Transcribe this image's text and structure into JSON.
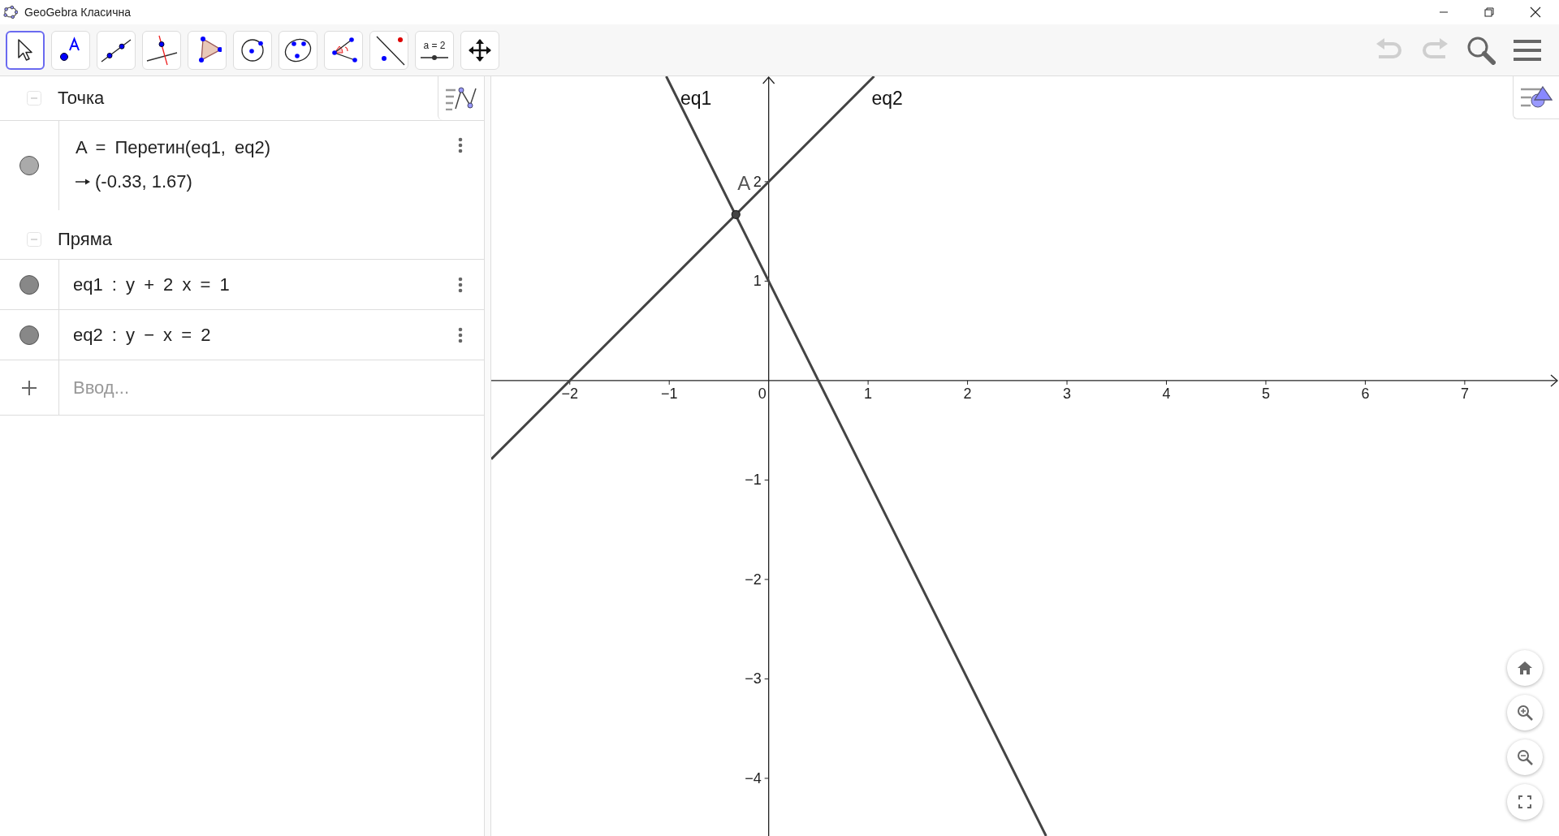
{
  "window": {
    "title": "GeoGebra Класична"
  },
  "toolbar": {
    "tools": [
      {
        "kind": "move",
        "selected": true
      },
      {
        "kind": "point",
        "selected": false
      },
      {
        "kind": "line",
        "selected": false
      },
      {
        "kind": "perpendicular",
        "selected": false
      },
      {
        "kind": "polygon",
        "selected": false
      },
      {
        "kind": "circle",
        "selected": false
      },
      {
        "kind": "conic",
        "selected": false
      },
      {
        "kind": "angle",
        "selected": false
      },
      {
        "kind": "reflect",
        "selected": false
      },
      {
        "kind": "slider",
        "selected": false,
        "label": "a = 2"
      },
      {
        "kind": "move_view",
        "selected": false
      }
    ],
    "undo_disabled": true,
    "redo_disabled": true
  },
  "algebra": {
    "groups": [
      {
        "title": "Точка",
        "expanded": true,
        "items": [
          {
            "kind": "point",
            "visible": true,
            "definition": "A = Перетин(eq1, eq2)",
            "value": "(-0.33, 1.67)"
          }
        ]
      },
      {
        "title": "Пряма",
        "expanded": true,
        "items": [
          {
            "kind": "line",
            "visible": true,
            "definition": "eq1 : y + 2 x = 1"
          },
          {
            "kind": "line",
            "visible": true,
            "definition": "eq2 : y − x = 2"
          }
        ]
      }
    ],
    "input": {
      "placeholder": "Ввод..."
    }
  },
  "graphics": {
    "chart_data": {
      "type": "line",
      "x": [
        -2.79,
        -1.03,
        1.06,
        2.79
      ],
      "series": [
        {
          "name": "eq1",
          "values": [
            null,
            3.06,
            -1.12,
            -4.58
          ]
        },
        {
          "name": "eq2",
          "values": [
            -0.79,
            0.97,
            3.06,
            null
          ]
        }
      ],
      "xlim": [
        -2.79,
        7.94
      ],
      "ylim": [
        -4.58,
        3.06
      ],
      "xticks": [
        {
          "value": -2,
          "label": "−2"
        },
        {
          "value": -1,
          "label": "−1"
        },
        0,
        1,
        2,
        3,
        4,
        5,
        6,
        7
      ],
      "yticks": [
        {
          "value": -4,
          "label": "−4"
        },
        {
          "value": -3,
          "label": "−3"
        },
        {
          "value": -2,
          "label": "−2"
        },
        {
          "value": -1,
          "label": "−1"
        },
        1,
        2
      ],
      "annotations": [
        {
          "x": -0.33,
          "y": 1.67,
          "text": "A"
        }
      ]
    }
  }
}
